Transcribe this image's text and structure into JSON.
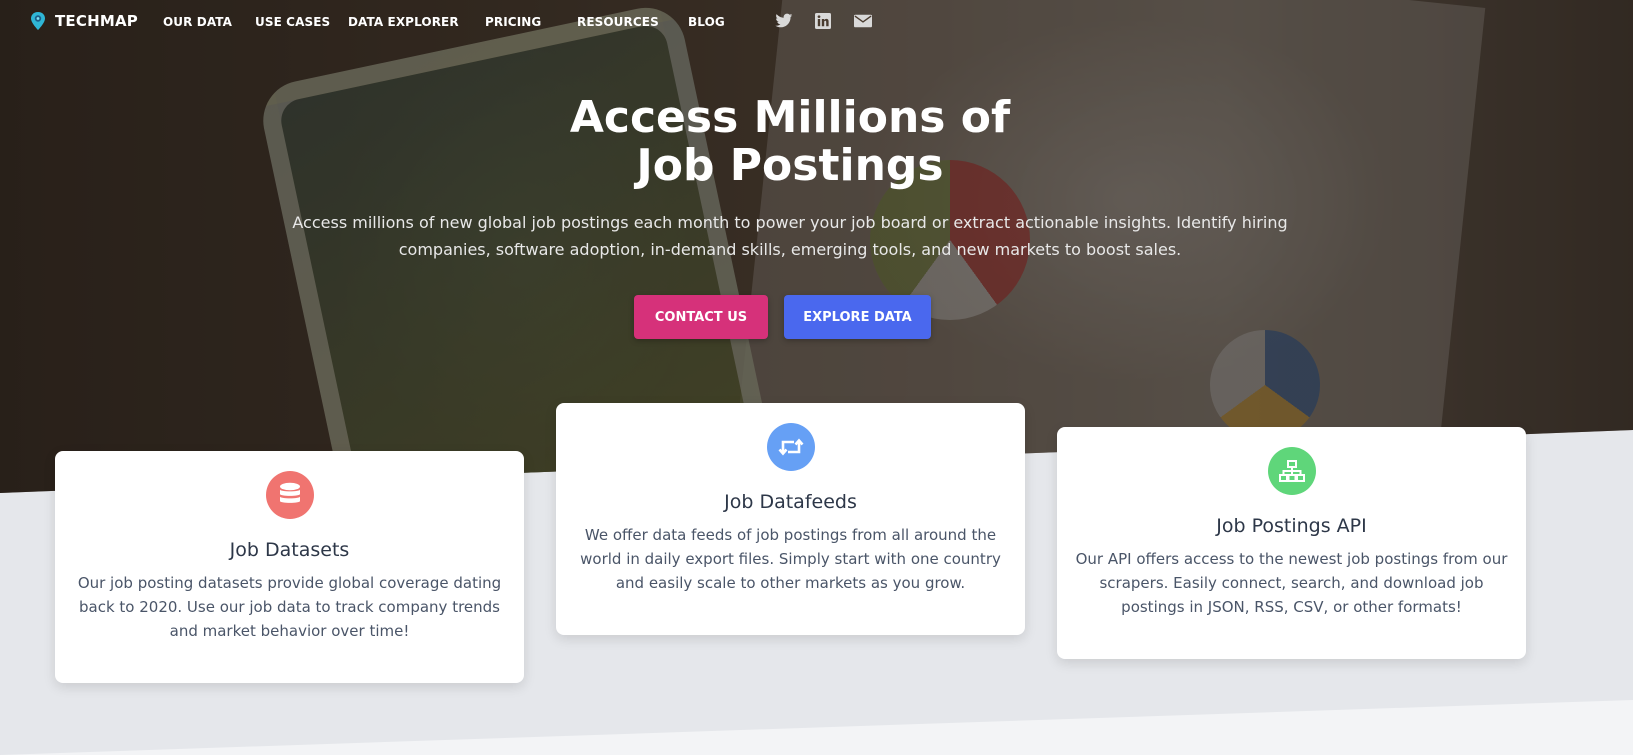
{
  "brand": {
    "name": "TECHMAP"
  },
  "nav": {
    "items": [
      {
        "label": "OUR DATA"
      },
      {
        "label": "USE CASES"
      },
      {
        "label": "DATA EXPLORER"
      },
      {
        "label": "PRICING"
      },
      {
        "label": "RESOURCES"
      },
      {
        "label": "BLOG"
      }
    ],
    "social": [
      "twitter-icon",
      "linkedin-icon",
      "envelope-icon"
    ]
  },
  "hero": {
    "title_line1": "Access Millions of",
    "title_line2": "Job Postings",
    "subtitle": "Access millions of new global job postings each month to power your job board or extract actionable insights. Identify hiring companies, software adoption, in-demand skills, emerging tools, and new markets to boost sales.",
    "contact_label": "CONTACT US",
    "explore_label": "EXPLORE DATA"
  },
  "colors": {
    "contact": "#d6317a",
    "explore": "#4a68ee",
    "datasets_icon": "#f07470",
    "datafeeds_icon": "#66a0f5",
    "api_icon": "#5fd67a"
  },
  "cards": [
    {
      "icon": "database-icon",
      "title": "Job Datasets",
      "text": "Our job posting datasets provide global coverage dating back to 2020. Use our job data to track company trends and market behavior over time!"
    },
    {
      "icon": "retweet-icon",
      "title": "Job Datafeeds",
      "text": "We offer data feeds of job postings from all around the world in daily export files. Simply start with one country and easily scale to other markets as you grow."
    },
    {
      "icon": "sitemap-icon",
      "title": "Job Postings API",
      "text": "Our API offers access to the newest job postings from our scrapers. Easily connect, search, and download job postings in JSON, RSS, CSV, or other formats!"
    }
  ]
}
